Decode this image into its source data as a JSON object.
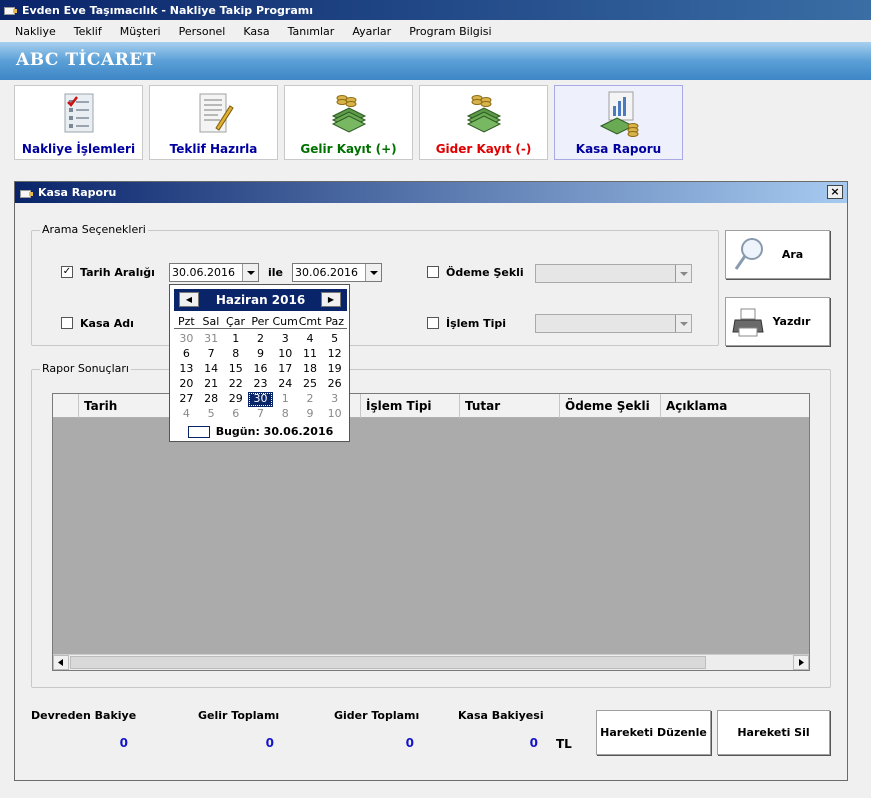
{
  "window": {
    "title": "Evden Eve Taşımacılık - Nakliye Takip Programı"
  },
  "menu": [
    "Nakliye",
    "Teklif",
    "Müşteri",
    "Personel",
    "Kasa",
    "Tanımlar",
    "Ayarlar",
    "Program Bilgisi"
  ],
  "brand": "ABC TİCARET",
  "toolbar": {
    "items": [
      {
        "label": "Nakliye İşlemleri",
        "icon": "checklist-icon",
        "color": "#0000a0"
      },
      {
        "label": "Teklif Hazırla",
        "icon": "document-pen-icon",
        "color": "#0000a0"
      },
      {
        "label": "Gelir Kayıt (+)",
        "icon": "money-stack-icon",
        "color": "#007000"
      },
      {
        "label": "Gider Kayıt (-)",
        "icon": "money-stack-icon",
        "color": "#e00000"
      },
      {
        "label": "Kasa Raporu",
        "icon": "report-money-icon",
        "color": "#0000a0"
      }
    ]
  },
  "child": {
    "title": "Kasa Raporu",
    "close": "×"
  },
  "search": {
    "legend": "Arama Seçenekleri",
    "date_range_label": "Tarih Aralığı",
    "date_range_checked": "✓",
    "date_from": "30.06.2016",
    "between": "ile",
    "date_to": "30.06.2016",
    "kasa_label": "Kasa Adı",
    "payment_label": "Ödeme Şekli",
    "type_label": "İşlem Tipi",
    "search_button": "Ara",
    "print_button": "Yazdır"
  },
  "results": {
    "legend": "Rapor Sonuçları",
    "columns": [
      "",
      "Tarih",
      "",
      "İşlem Tipi",
      "Tutar",
      "Ödeme Şekli",
      "Açıklama"
    ]
  },
  "calendar": {
    "month": "Haziran 2016",
    "prev": "◀",
    "next": "▶",
    "days": [
      "Pzt",
      "Sal",
      "Çar",
      "Per",
      "Cum",
      "Cmt",
      "Paz"
    ],
    "weeks": [
      [
        "30",
        "31",
        "1",
        "2",
        "3",
        "4",
        "5"
      ],
      [
        "6",
        "7",
        "8",
        "9",
        "10",
        "11",
        "12"
      ],
      [
        "13",
        "14",
        "15",
        "16",
        "17",
        "18",
        "19"
      ],
      [
        "20",
        "21",
        "22",
        "23",
        "24",
        "25",
        "26"
      ],
      [
        "27",
        "28",
        "29",
        "30",
        "1",
        "2",
        "3"
      ],
      [
        "4",
        "5",
        "6",
        "7",
        "8",
        "9",
        "10"
      ]
    ],
    "today": "Bugün: 30.06.2016"
  },
  "totals": {
    "carry_label": "Devreden Bakiye",
    "carry_value": "0",
    "income_label": "Gelir Toplamı",
    "income_value": "0",
    "expense_label": "Gider Toplamı",
    "expense_value": "0",
    "balance_label": "Kasa Bakiyesi",
    "balance_value": "0",
    "currency": "TL"
  },
  "actions": {
    "edit": "Hareketi Düzenle",
    "delete": "Hareketi Sil"
  }
}
